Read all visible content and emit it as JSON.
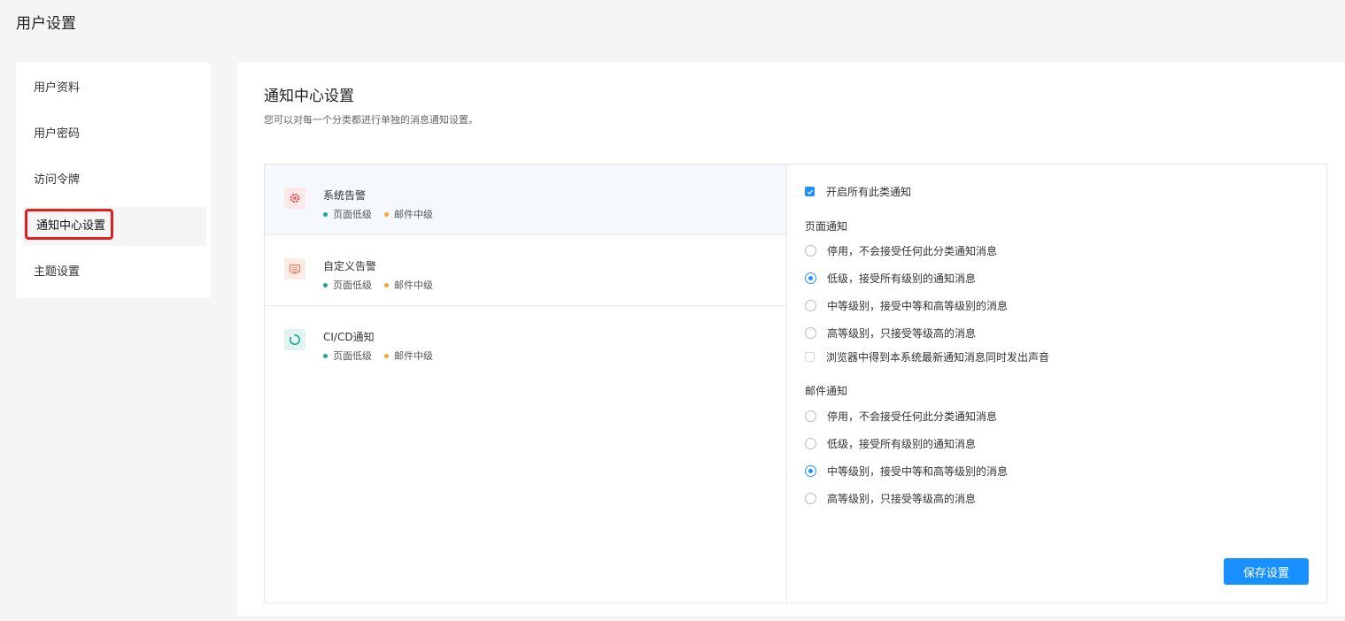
{
  "page_title": "用户设置",
  "sidebar": {
    "items": [
      {
        "label": "用户资料"
      },
      {
        "label": "用户密码"
      },
      {
        "label": "访问令牌"
      },
      {
        "label": "通知中心设置",
        "active": true
      },
      {
        "label": "主题设置"
      }
    ]
  },
  "main": {
    "title": "通知中心设置",
    "subtitle": "您可以对每一个分类都进行单独的消息通知设置。"
  },
  "categories": [
    {
      "name": "系统告警",
      "icon": "gear-icon",
      "icon_color": "#e85a5a",
      "icon_bg": "#fde8e8",
      "page_level": "页面低级",
      "mail_level": "邮件中级"
    },
    {
      "name": "自定义告警",
      "icon": "message-icon",
      "icon_color": "#f07a5a",
      "icon_bg": "#fdece6",
      "page_level": "页面低级",
      "mail_level": "邮件中级"
    },
    {
      "name": "CI/CD通知",
      "icon": "refresh-icon",
      "icon_color": "#1aa68f",
      "icon_bg": "#e2f4f1",
      "page_level": "页面低级",
      "mail_level": "邮件中级"
    }
  ],
  "colors": {
    "page_dot": "#1aa68f",
    "mail_dot": "#f5a623",
    "accent": "#1890ff"
  },
  "settings": {
    "enable_all": {
      "label": "开启所有此类通知",
      "checked": true
    },
    "page_section": "页面通知",
    "page_options": [
      {
        "label": "停用，不会接受任何此分类通知消息",
        "selected": false
      },
      {
        "label": "低级，接受所有级别的通知消息",
        "selected": true
      },
      {
        "label": "中等级别，接受中等和高等级别的消息",
        "selected": false
      },
      {
        "label": "高等级别，只接受等级高的消息",
        "selected": false
      }
    ],
    "browser_sound": {
      "label": "浏览器中得到本系统最新通知消息同时发出声音",
      "checked": false
    },
    "mail_section": "邮件通知",
    "mail_options": [
      {
        "label": "停用，不会接受任何此分类通知消息",
        "selected": false
      },
      {
        "label": "低级，接受所有级别的通知消息",
        "selected": false
      },
      {
        "label": "中等级别，接受中等和高等级别的消息",
        "selected": true
      },
      {
        "label": "高等级别，只接受等级高的消息",
        "selected": false
      }
    ],
    "save_label": "保存设置"
  }
}
